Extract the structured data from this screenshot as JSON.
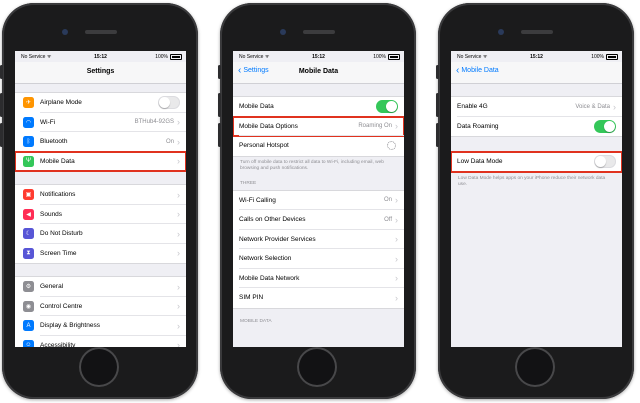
{
  "status_bar": {
    "carrier": "No Service",
    "time": "15:12",
    "battery": "100%"
  },
  "phone1": {
    "nav": {
      "title": "Settings"
    },
    "group1": [
      {
        "label": "Airplane Mode",
        "icon": "airplane-icon",
        "color": "#ff9500",
        "glyph": "✈",
        "control": "toggle-off"
      },
      {
        "label": "Wi-Fi",
        "icon": "wifi-icon",
        "color": "#007aff",
        "glyph": "◠",
        "value": "BTHub4-92GS"
      },
      {
        "label": "Bluetooth",
        "icon": "bluetooth-icon",
        "color": "#007aff",
        "glyph": "ᛒ",
        "value": "On"
      },
      {
        "label": "Mobile Data",
        "icon": "antenna-icon",
        "color": "#34c759",
        "glyph": "Ψ",
        "highlighted": true
      }
    ],
    "group2": [
      {
        "label": "Notifications",
        "icon": "notifications-icon",
        "color": "#ff3b30",
        "glyph": "▣"
      },
      {
        "label": "Sounds",
        "icon": "speaker-icon",
        "color": "#ff2d55",
        "glyph": "◀"
      },
      {
        "label": "Do Not Disturb",
        "icon": "moon-icon",
        "color": "#5856d6",
        "glyph": "☾"
      },
      {
        "label": "Screen Time",
        "icon": "hourglass-icon",
        "color": "#5856d6",
        "glyph": "⧗"
      }
    ],
    "group3": [
      {
        "label": "General",
        "icon": "gear-icon",
        "color": "#8e8e93",
        "glyph": "⚙"
      },
      {
        "label": "Control Centre",
        "icon": "control-centre-icon",
        "color": "#8e8e93",
        "glyph": "◉"
      },
      {
        "label": "Display & Brightness",
        "icon": "text-size-icon",
        "color": "#007aff",
        "glyph": "A"
      },
      {
        "label": "Accessibility",
        "icon": "accessibility-icon",
        "color": "#007aff",
        "glyph": "☺"
      }
    ]
  },
  "phone2": {
    "nav": {
      "back": "Settings",
      "title": "Mobile Data"
    },
    "group1": [
      {
        "label": "Mobile Data",
        "control": "toggle-on"
      },
      {
        "label": "Mobile Data Options",
        "value": "Roaming On",
        "highlighted": true
      },
      {
        "label": "Personal Hotspot",
        "control": "spinner"
      }
    ],
    "note": "Turn off mobile data to restrict all data to Wi-Fi, including email, web browsing and push notifications.",
    "section": "THREE",
    "group2": [
      {
        "label": "Wi-Fi Calling",
        "value": "On"
      },
      {
        "label": "Calls on Other Devices",
        "value": "Off"
      },
      {
        "label": "Network Provider Services"
      },
      {
        "label": "Network Selection"
      },
      {
        "label": "Mobile Data Network"
      },
      {
        "label": "SIM PIN"
      }
    ],
    "footer_section": "MOBILE DATA"
  },
  "phone3": {
    "nav": {
      "back": "Mobile Data",
      "title": ""
    },
    "group1": [
      {
        "label": "Enable 4G",
        "value": "Voice & Data"
      },
      {
        "label": "Data Roaming",
        "control": "toggle-on"
      }
    ],
    "group2": [
      {
        "label": "Low Data Mode",
        "control": "toggle-off",
        "highlighted": true
      }
    ],
    "note": "Low Data Mode helps apps on your iPhone reduce their network data use."
  },
  "colors": {
    "accent": "#007aff",
    "toggle_on": "#34c759",
    "highlight": "#e0321f"
  }
}
